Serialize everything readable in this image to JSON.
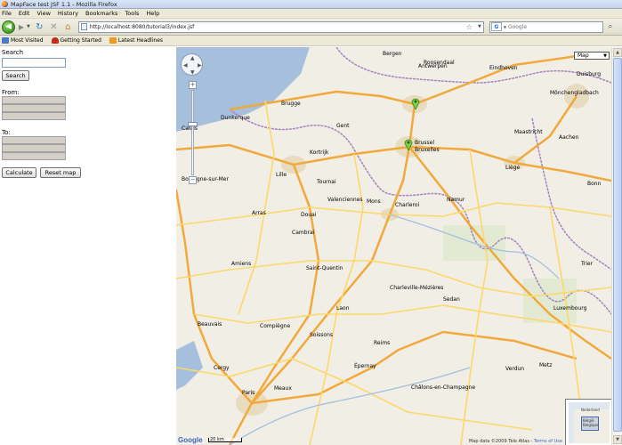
{
  "window": {
    "title": "MapFace test JSF 1.1 - Mozilla Firefox"
  },
  "menu": [
    "File",
    "Edit",
    "View",
    "History",
    "Bookmarks",
    "Tools",
    "Help"
  ],
  "nav": {
    "url": "http://localhost:8080/tutorial3/index.jsf",
    "search_placeholder": "Google",
    "search_engine": "G"
  },
  "bookmarks": [
    "Most Visited",
    "Getting Started",
    "Latest Headlines"
  ],
  "form": {
    "search_label": "Search",
    "search_value": "",
    "search_button": "Search",
    "from_label": "From:",
    "to_label": "To:",
    "calculate_button": "Calculate",
    "reset_button": "Reset map"
  },
  "map": {
    "type_label": "Map",
    "logo": "Google",
    "scale_label": "20 km",
    "copyright": "Map data ©2009 Tele Atlas -",
    "terms": "Terms of Use",
    "overview_labels": [
      "Nederland",
      "België",
      "Belgique"
    ],
    "cities": [
      "Antwerpen",
      "Brussel",
      "Bruxelles",
      "Gent",
      "Brugge",
      "Lille",
      "Kortrijk",
      "Tournai",
      "Mons",
      "Charleroi",
      "Namur",
      "Liège",
      "Maastricht",
      "Aachen",
      "Eindhoven",
      "Roosendaal",
      "Duisburg",
      "Mönchengladbach",
      "Dunkerque",
      "Calais",
      "Boulogne-sur-Mer",
      "Arras",
      "Douai",
      "Valenciennes",
      "Cambrai",
      "Amiens",
      "Saint-Quentin",
      "Laon",
      "Reims",
      "Charleville-Mézières",
      "Sedan",
      "Luxembourg",
      "Metz",
      "Trier",
      "Châlons-en-Champagne",
      "Beauvais",
      "Compiègne",
      "Soissons",
      "Cergy",
      "Paris",
      "Meaux",
      "Épernay",
      "Verdun",
      "Bergen",
      "Bonn"
    ]
  },
  "colors": {
    "map_land": "#f1eee6",
    "motorway": "#f2a93b",
    "primary_road": "#fdd86a",
    "border": "#a584c0",
    "water": "#a5bfdd",
    "marker": "#7bd24a"
  }
}
